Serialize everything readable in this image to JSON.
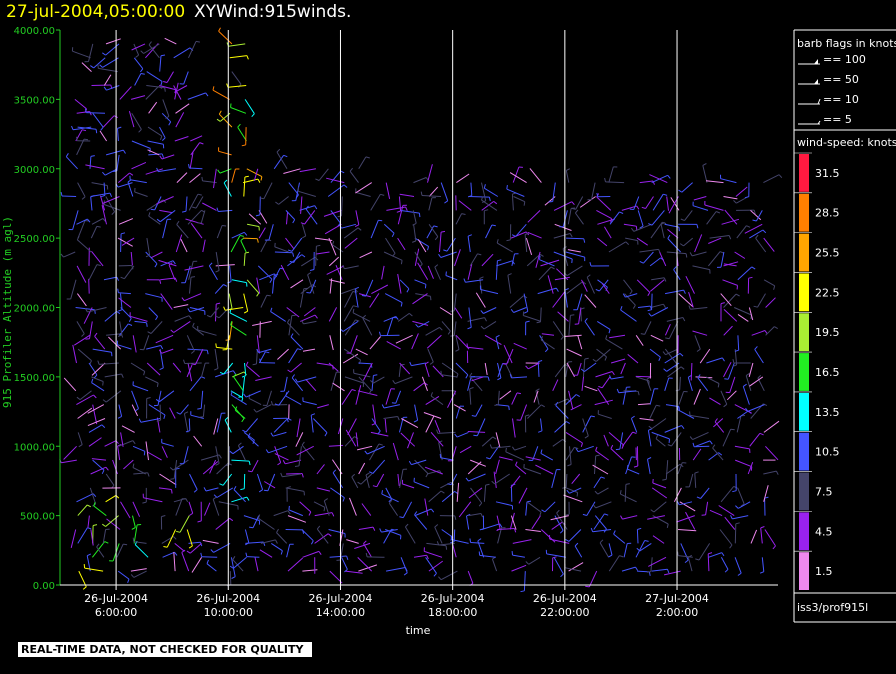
{
  "header": {
    "date_time": "27-jul-2004,05:00:00",
    "product": "XYWind:915winds."
  },
  "notice": "REAL-TIME DATA, NOT CHECKED FOR QUALITY",
  "source_label": "iss3/prof915l",
  "colors": {
    "background": "#000000",
    "title_date": "#ffff00",
    "title_main": "#ffffff",
    "y_axis": "#22cc22",
    "x_axis": "#ffffff",
    "gridline": "#ffffff"
  },
  "chart_data": {
    "type": "wind-barb time-height plot",
    "ylabel": "915 Profiler Altitude (m agl)",
    "xlabel": "time",
    "y_ticks": [
      "0.00",
      "500.00",
      "1000.00",
      "1500.00",
      "2000.00",
      "2500.00",
      "3000.00",
      "3500.00",
      "4000.00"
    ],
    "ylim": [
      0,
      4000
    ],
    "x_ticks": [
      {
        "hour": 6,
        "date": "26-Jul-2004",
        "time": "6:00:00"
      },
      {
        "hour": 10,
        "date": "26-Jul-2004",
        "time": "10:00:00"
      },
      {
        "hour": 14,
        "date": "26-Jul-2004",
        "time": "14:00:00"
      },
      {
        "hour": 18,
        "date": "26-Jul-2004",
        "time": "18:00:00"
      },
      {
        "hour": 22,
        "date": "26-Jul-2004",
        "time": "22:00:00"
      },
      {
        "hour": 26,
        "date": "27-Jul-2004",
        "time": "2:00:00"
      }
    ],
    "xlim_hours": [
      4.0,
      29.6
    ],
    "grid_vertical": true,
    "barb_legend": {
      "title": "barb flags in knots",
      "entries": [
        {
          "value": 100,
          "label": "== 100"
        },
        {
          "value": 50,
          "label": "== 50"
        },
        {
          "value": 10,
          "label": "== 10"
        },
        {
          "value": 5,
          "label": "== 5"
        }
      ]
    },
    "color_scale": {
      "title": "wind-speed: knots",
      "bins": [
        {
          "label": "31.5",
          "color": "#ff1a40"
        },
        {
          "label": "28.5",
          "color": "#ff7f00"
        },
        {
          "label": "25.5",
          "color": "#ffa500"
        },
        {
          "label": "22.5",
          "color": "#ffff00"
        },
        {
          "label": "19.5",
          "color": "#aaee33"
        },
        {
          "label": "16.5",
          "color": "#22ee22"
        },
        {
          "label": "13.5",
          "color": "#00ffff"
        },
        {
          "label": "10.5",
          "color": "#4455ff"
        },
        {
          "label": "7.5",
          "color": "#44446a"
        },
        {
          "label": "4.5",
          "color": "#9922ee"
        },
        {
          "label": "1.5",
          "color": "#ee88ee"
        }
      ]
    },
    "wind_field": {
      "description": "dense field of wind barbs at 100 m height gates for each hourly profile",
      "height_gates_m": [
        100,
        3900
      ],
      "gate_spacing_m": 100,
      "profile_interval_hours": 0.5,
      "dominant_speed_bins": [
        "4.5",
        "7.5",
        "10.5"
      ],
      "high_speed_column_hours": [
        9.8,
        10.6
      ]
    }
  }
}
